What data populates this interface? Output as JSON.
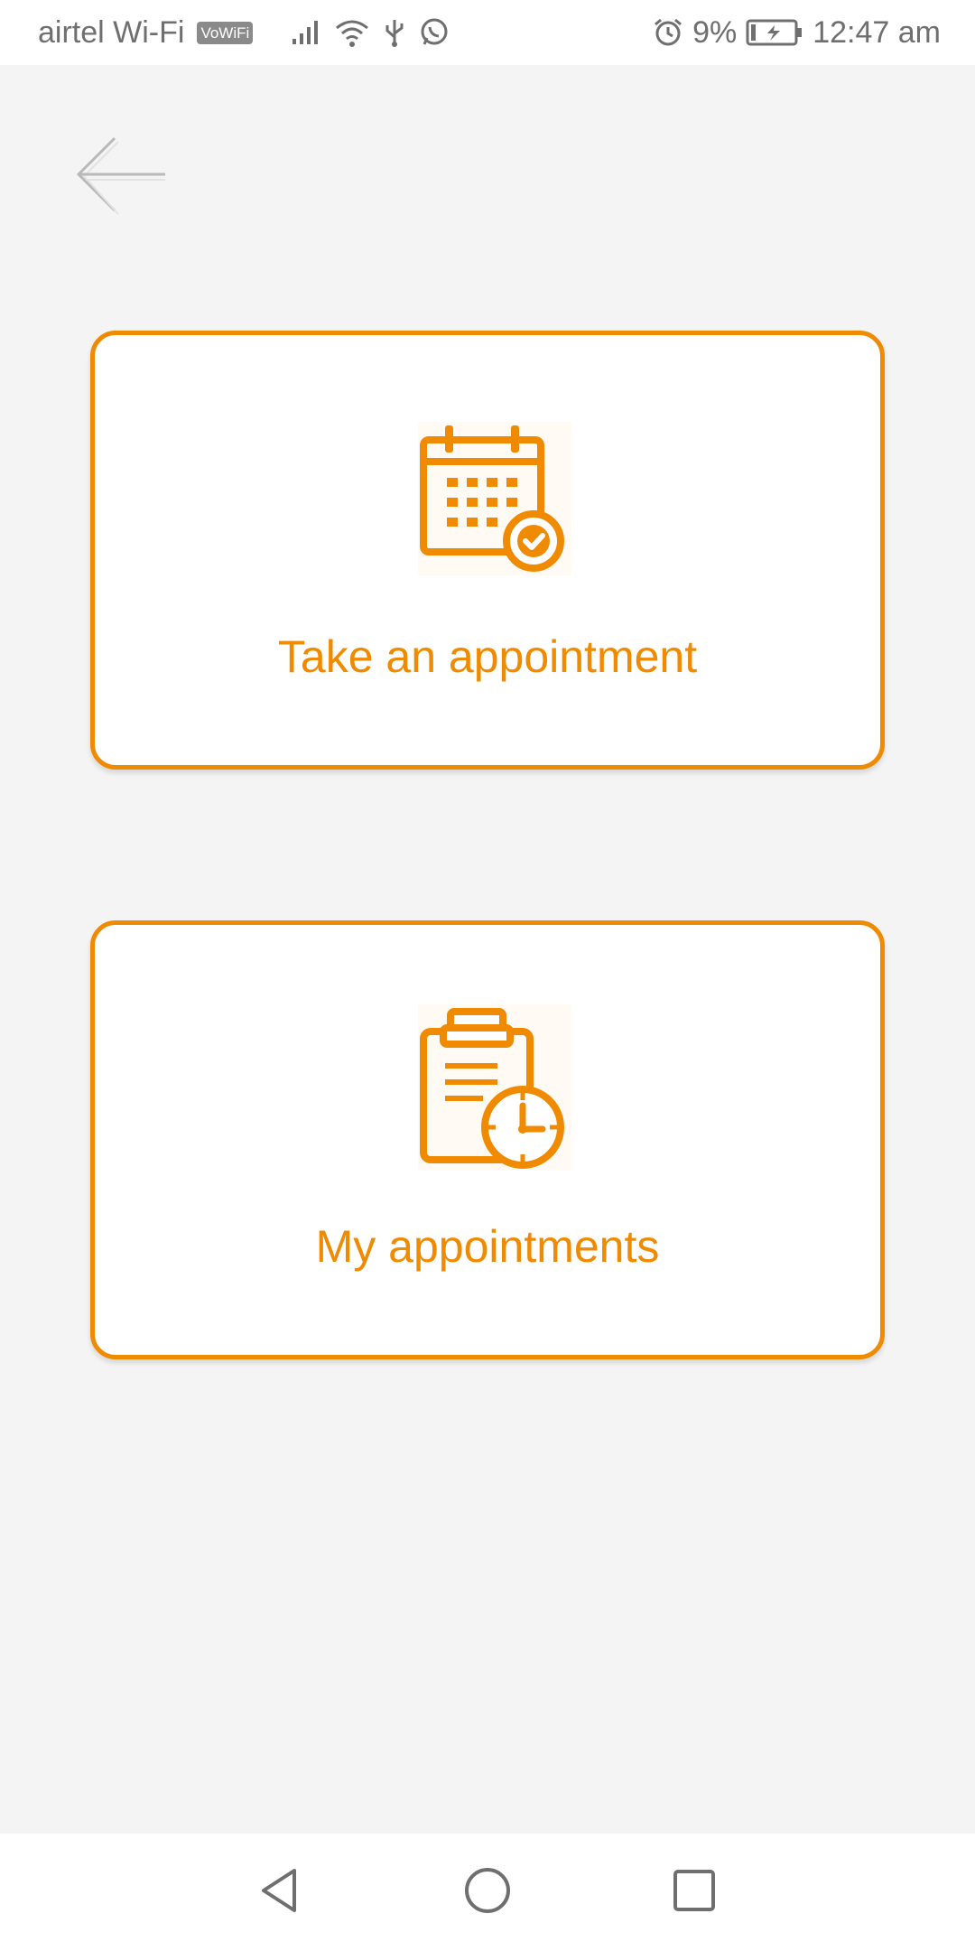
{
  "status_bar": {
    "carrier": "airtel Wi-Fi",
    "vowifi_badge": "VoWiFi",
    "battery_percent": "9%",
    "time": "12:47 am",
    "icons": [
      "signal-icon",
      "wifi-icon",
      "usb-icon",
      "whatsapp-icon",
      "alarm-icon",
      "battery-charging-icon"
    ]
  },
  "header": {
    "back_icon": "arrow-left-icon"
  },
  "cards": {
    "take": {
      "label": "Take an appointment",
      "icon": "calendar-check-icon"
    },
    "my": {
      "label": "My appointments",
      "icon": "clipboard-clock-icon"
    }
  },
  "nav_bar": {
    "icons": [
      "nav-back-icon",
      "nav-home-icon",
      "nav-recents-icon"
    ]
  },
  "colors": {
    "accent": "#f08a00",
    "background": "#f4f4f4",
    "card_background": "#ffffff",
    "status_text": "#6f6f6f"
  }
}
